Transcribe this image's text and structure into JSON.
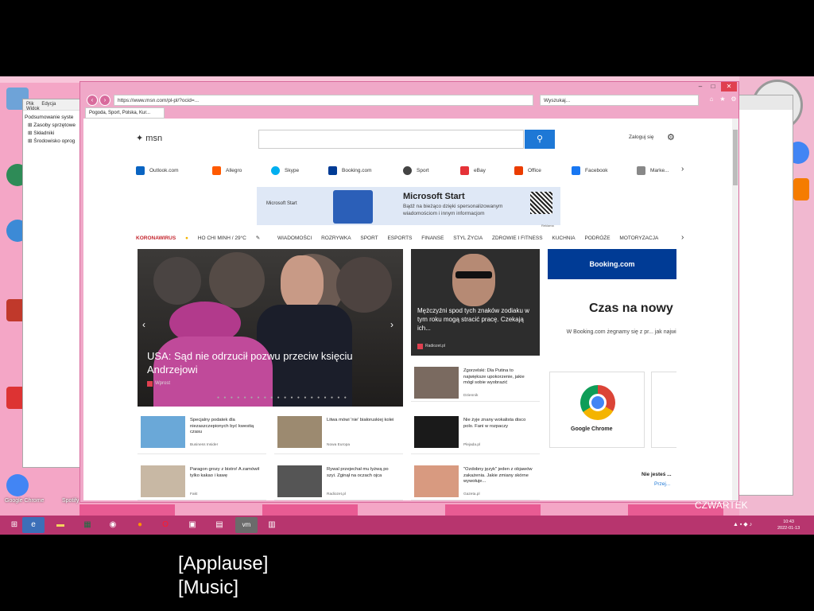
{
  "captions": [
    "[Applause]",
    "[Music]"
  ],
  "browser": {
    "url": "https://www.msn.com/pl-pl/?ocid=...",
    "search_placeholder": "Wyszukaj...",
    "tab_title": "Pogoda, Sport, Polska, Kur..."
  },
  "back_window": {
    "menu": [
      "Plik",
      "Edycja",
      "Widok"
    ],
    "tree": [
      "Podsumowanie syste",
      "Zasoby sprzętowe",
      "Składniki",
      "Środowisko oprog"
    ]
  },
  "msn": {
    "logo": "msn",
    "signin": "Zaloguj się",
    "quicklinks": [
      {
        "label": "Outlook.com",
        "color": "#0a64c2"
      },
      {
        "label": "Allegro",
        "color": "#ff5a00"
      },
      {
        "label": "Skype",
        "color": "#00aff0"
      },
      {
        "label": "Booking.com",
        "color": "#003b95"
      },
      {
        "label": "Sport",
        "color": "#444444"
      },
      {
        "label": "eBay",
        "color": "#e53238"
      },
      {
        "label": "Office",
        "color": "#eb3c00"
      },
      {
        "label": "Facebook",
        "color": "#1877f2"
      },
      {
        "label": "Marke...",
        "color": "#888888"
      }
    ],
    "banner": {
      "brand": "Microsoft Start",
      "title": "Microsoft Start",
      "text": "Bądź na bieżąco dzięki spersonalizowanym wiadomościom i innym informacjom",
      "ad_label": "Reklama"
    },
    "nav": [
      "KORONAWIRUS",
      "HO CHI MINH / 29°C",
      "WIADOMOŚCI",
      "ROZRYWKA",
      "SPORT",
      "ESPORTS",
      "FINANSE",
      "STYL ŻYCIA",
      "ZDROWIE I FITNESS",
      "KUCHNIA",
      "PODRÓŻE",
      "MOTORYZACJA"
    ],
    "hero": {
      "title": "USA: Sąd nie odrzucił pozwu przeciw księciu Andrzejowi",
      "source": "Wprost"
    },
    "card_men": {
      "title": "Mężczyźni spod tych znaków zodiaku w tym roku mogą stracić pracę. Czekają ich...",
      "source": "Radiozet.pl"
    },
    "cards": [
      {
        "title": "Zgorzelski: Dla Putina to największe upokorzenie, jakie mógł sobie wyobrazić",
        "source": "Dziennik",
        "thumb": "#7a6a60"
      },
      {
        "title": "Specjalny podatek dla niezaszczepionych być kwestią czasu",
        "source": "Business Insider",
        "thumb": "#6aa8d8"
      },
      {
        "title": "Litwa mówi 'nie' białoruskiej kolei",
        "source": "Nowa Europa",
        "thumb": "#9c8a70"
      },
      {
        "title": "Nie żyje znany wokalista disco polo. Fani w rozpaczy",
        "source": "Plejada.pl",
        "thumb": "#1a1a1a"
      },
      {
        "title": "Paragon grozy z bistro! A zamówił tylko kakao i kawę",
        "source": "Fakt",
        "thumb": "#c8b8a4"
      },
      {
        "title": "Rywal przejechał mu łyżwą po szyi. Zginął na oczach ojca",
        "source": "Radiozet.pl",
        "thumb": "#555555"
      },
      {
        "title": "\"Ozdobny język\" jeden z objawów zakażenia. Jakie zmiany skórne wywołuje...",
        "source": "Gazeta.pl",
        "thumb": "#d89a80"
      }
    ],
    "booking": {
      "brand": "Booking.com",
      "headline": "Czas na nowy",
      "text": "W Booking.com żegnamy się z pr... jak najwięcej...",
      "chrome_label": "Google Chrome",
      "nie_jestes": "Nie jesteś ...",
      "link": "Przej..."
    }
  },
  "taskbar": {
    "time": "10:43",
    "date": "2022-01-13",
    "day": "CZWARTEK"
  },
  "colors": {
    "desktop_pink": "#f4a6c6",
    "taskbar": "#b7356e",
    "msn_blue": "#1e78d6",
    "booking_blue": "#003b95"
  }
}
